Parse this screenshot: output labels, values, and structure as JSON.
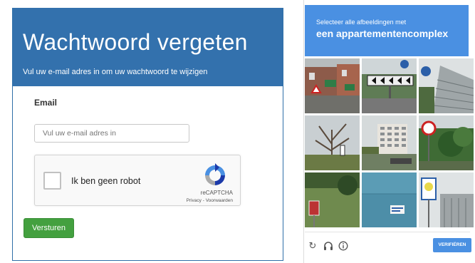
{
  "left_form": {
    "title": "Wachtwoord vergeten",
    "subtitle": "Vul uw e-mail adres in om uw wachtwoord te wijzigen",
    "email_label": "Email",
    "email_placeholder": "Vul uw e-mail adres in",
    "email_value": "",
    "submit_label": "Versturen",
    "accent_color": "#3371ad",
    "submit_color": "#43a03f"
  },
  "recaptcha": {
    "checkbox_label": "Ik ben geen robot",
    "brand": "reCAPTCHA",
    "links": "Privacy - Voorwaarden",
    "checked": false,
    "logo_icon": "recaptcha-logo-icon"
  },
  "captcha_challenge": {
    "instruction_small": "Selecteer alle afbeeldingen met",
    "instruction_big": "een appartementencomplex",
    "header_color": "#4a90e2",
    "tiles": [
      "street-houses-tile",
      "road-chevron-sign-tile",
      "tall-building-tile",
      "bare-tree-tile",
      "apartment-block-tile",
      "speed-sign-tile",
      "red-sign-grass-tile",
      "blue-wall-tile",
      "bus-stop-sign-tile"
    ],
    "footer_icons": [
      "reload-icon",
      "headphones-icon",
      "info-icon"
    ],
    "verify_label": "VERIFIËREN"
  }
}
